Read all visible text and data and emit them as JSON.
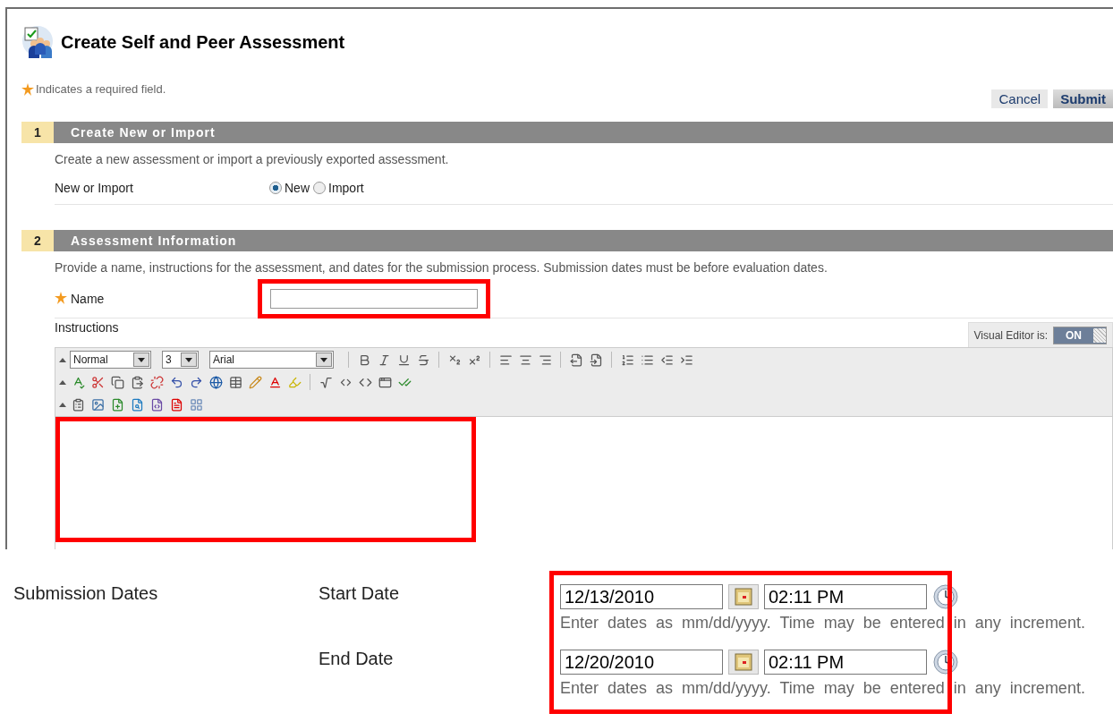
{
  "page": {
    "title": "Create Self and Peer Assessment",
    "required_note": "Indicates a required field."
  },
  "buttons": [
    {
      "label": "Cancel",
      "kind": "secondary"
    },
    {
      "label": "Submit",
      "kind": "primary"
    }
  ],
  "step1": {
    "number": "1",
    "title": "Create New or Import",
    "description": "Create a new assessment or import a previously exported assessment.",
    "field_label": "New or Import",
    "options": [
      {
        "label": "New",
        "selected": true
      },
      {
        "label": "Import",
        "selected": false
      }
    ]
  },
  "step2": {
    "number": "2",
    "title": "Assessment Information",
    "description": "Provide a name, instructions for the assessment, and dates for the submission process. Submission dates must be before evaluation dates.",
    "name_field": {
      "label": "Name",
      "required": true,
      "highlighted": true
    },
    "instructions": {
      "label": "Instructions",
      "visual_editor": {
        "label": "Visual Editor is:",
        "state": "ON",
        "on": true
      },
      "format": "Normal",
      "size": "3",
      "font": "Arial",
      "highlighted": true
    }
  },
  "submission": {
    "label": "Submission Dates",
    "highlighted": true,
    "dates": [
      {
        "label": "Start Date",
        "date": "12/13/2010",
        "time": "02:11 PM",
        "hint": "Enter dates as mm/dd/yyyy. Time may be entered in any increment."
      },
      {
        "label": "End Date",
        "date": "12/20/2010",
        "time": "02:11 PM",
        "hint": "Enter dates as mm/dd/yyyy. Time may be entered in any increment."
      }
    ]
  }
}
